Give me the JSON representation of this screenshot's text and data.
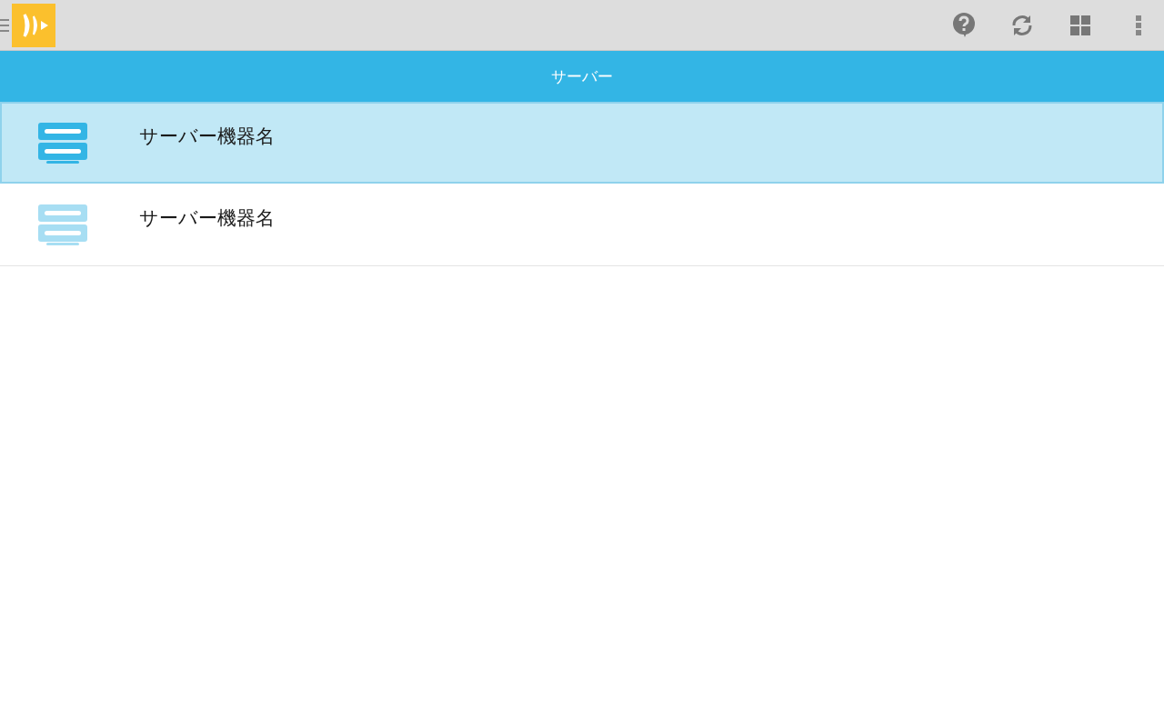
{
  "header": {
    "title": "サーバー"
  },
  "servers": [
    {
      "name": "サーバー機器名",
      "selected": true
    },
    {
      "name": "サーバー機器名",
      "selected": false
    }
  ]
}
